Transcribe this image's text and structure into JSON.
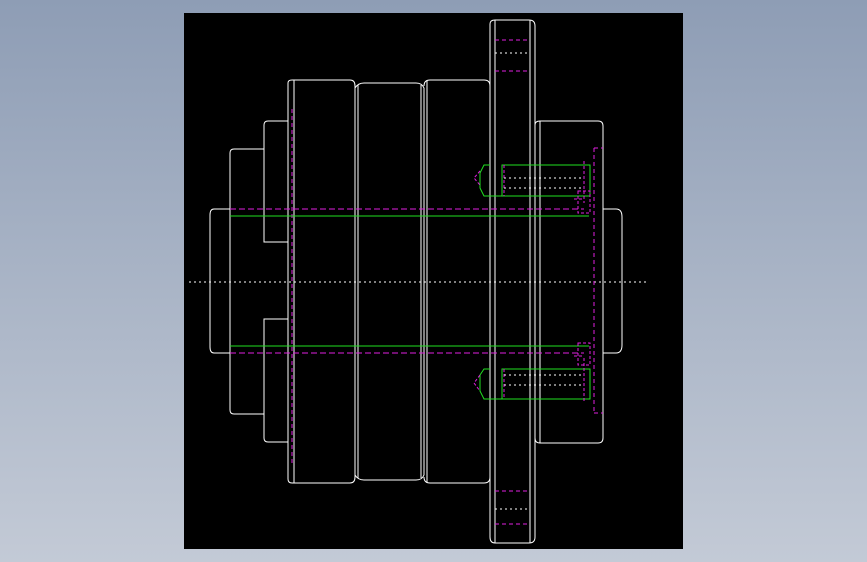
{
  "drawing": {
    "background": "#000000",
    "colors": {
      "outline": "#ffffff",
      "hidden": "#e020e0",
      "highlight": "#20e020",
      "centerline": "#ffffff"
    },
    "components": [
      "left-hub",
      "hub-step",
      "main-body",
      "flange-disc",
      "right-hub",
      "shaft-bore",
      "bolt-upper",
      "bolt-lower",
      "centerline"
    ]
  }
}
